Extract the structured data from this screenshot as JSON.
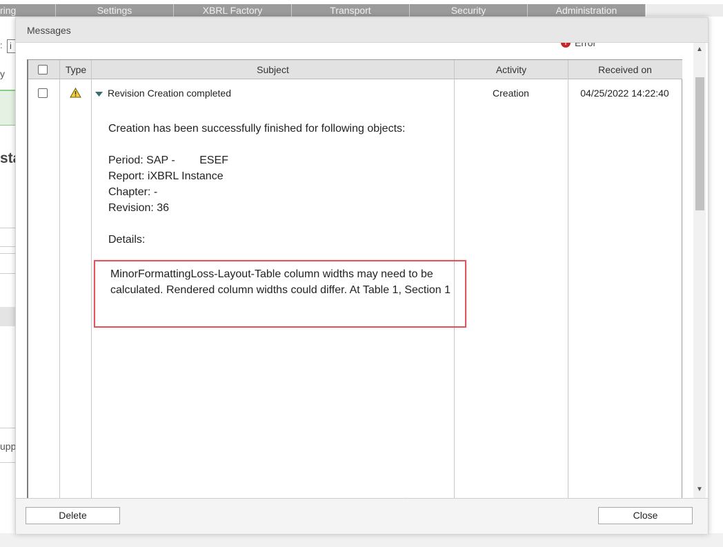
{
  "background": {
    "nav_tabs": [
      {
        "label": "ring"
      },
      {
        "label": "Settings"
      },
      {
        "label": "XBRL Factory"
      },
      {
        "label": "Transport"
      },
      {
        "label": "Security"
      },
      {
        "label": "Administration"
      }
    ],
    "field_prefix": ":",
    "field_value": "i",
    "side_text_1": "y",
    "side_text_2": "sta",
    "side_text_3": "upp"
  },
  "modal": {
    "title": "Messages",
    "legend_error": "Error",
    "columns": {
      "type": "Type",
      "subject": "Subject",
      "activity": "Activity",
      "received_on": "Received on"
    },
    "row": {
      "subject": "Revision Creation completed",
      "activity": "Creation",
      "received_on": "04/25/2022 14:22:40",
      "icon": "warning-icon"
    },
    "body": {
      "intro": "Creation has been successfully finished for following objects:",
      "period": "Period: SAP -        ESEF",
      "report": "Report: iXBRL Instance",
      "chapter": "Chapter: -",
      "revision": "Revision: 36",
      "details_label": "Details:",
      "details_text": "MinorFormattingLoss-Layout-Table column widths may need to be calculated. Rendered column widths could differ. At Table 1, Section 1"
    },
    "trail_1": "(",
    "trail_2": "·",
    "buttons": {
      "delete": "Delete",
      "close": "Close"
    }
  },
  "colors": {
    "header_bg": "#e2e2e2",
    "highlight_border": "#e0555c",
    "nav_tab_bg": "#9b9b9b",
    "error_red": "#c62828",
    "warning_yellow": "#f4d03f"
  }
}
